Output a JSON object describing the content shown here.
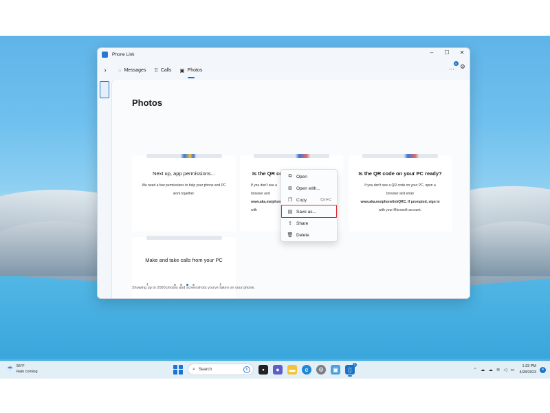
{
  "window": {
    "title": "Phone Link",
    "controls": {
      "minimize": "–",
      "maximize": "☐",
      "close": "✕"
    }
  },
  "nav": {
    "tabs": [
      {
        "label": "Messages",
        "icon": "chat-icon"
      },
      {
        "label": "Calls",
        "icon": "dialpad-icon"
      },
      {
        "label": "Photos",
        "icon": "photo-icon",
        "active": true
      }
    ],
    "more_badge": "5"
  },
  "page": {
    "title": "Photos",
    "footer_note": "Showing up to 2000 photos and screenshots you've taken on your phone."
  },
  "cards": [
    {
      "title": "Next up, app permissions...",
      "body": "We need a few permissions to help your phone and PC work together."
    },
    {
      "title": "Is the QR code on your PC ready?",
      "visible_title": "Is the QR cod",
      "body_lines": [
        "If you don't see a",
        "browser and",
        "www.aka.ms/phon",
        "with"
      ]
    },
    {
      "title": "Is the QR code on your PC ready?",
      "body_lines": [
        "If you don't see a QR code on your PC, open a",
        "browser and enter",
        "www.aka.ms/phonelinkQRC. If prompted, sign in",
        "with your Microsoft account."
      ]
    },
    {
      "title": "Make and take calls from your PC",
      "carousel": {
        "pages": 4,
        "active_index": 2
      }
    }
  ],
  "context_menu": {
    "items": [
      {
        "label": "Open",
        "icon": "open-icon",
        "shortcut": ""
      },
      {
        "label": "Open with...",
        "icon": "open-with-icon",
        "shortcut": ""
      },
      {
        "label": "Copy",
        "icon": "copy-icon",
        "shortcut": "Ctrl+C"
      },
      {
        "label": "Save as...",
        "icon": "save-icon",
        "shortcut": "",
        "highlighted": true
      },
      {
        "label": "Share",
        "icon": "share-icon",
        "shortcut": ""
      },
      {
        "label": "Delete",
        "icon": "trash-icon",
        "shortcut": ""
      }
    ]
  },
  "taskbar": {
    "weather": {
      "temp": "55°F",
      "condition": "Rain coming"
    },
    "search_label": "Search",
    "phone_link_badge": "5",
    "clock": {
      "time": "1:33 PM",
      "date": "4/28/2023"
    },
    "notifications": "4"
  },
  "colors": {
    "accent": "#1a73c8",
    "highlight_box": "#d9262e"
  }
}
